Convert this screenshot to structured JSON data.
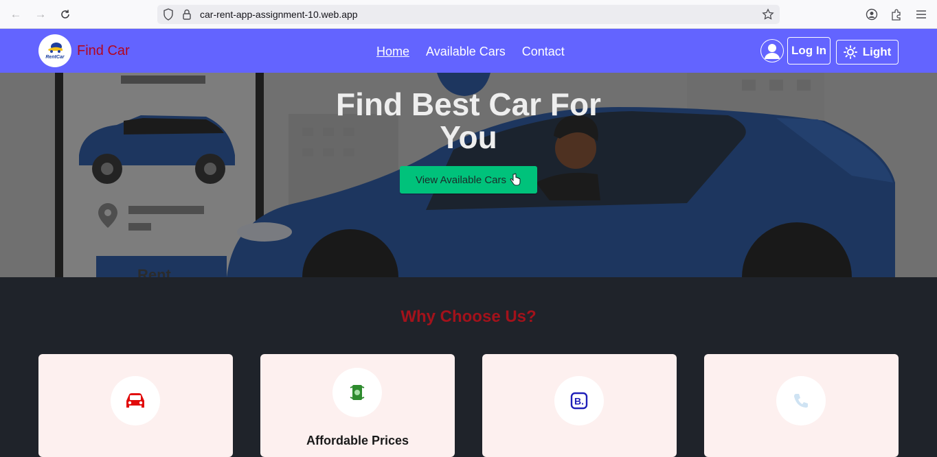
{
  "browser": {
    "url": "car-rent-app-assignment-10.web.app"
  },
  "navbar": {
    "logo_text": "RentCar",
    "brand": "Find Car",
    "links": [
      {
        "label": "Home"
      },
      {
        "label": "Available Cars"
      },
      {
        "label": "Contact"
      }
    ],
    "login_label": "Log In",
    "theme_label": "Light",
    "colors": {
      "background": "#6364ff",
      "brand": "#b3061f"
    }
  },
  "hero": {
    "title": "Find Best Car For You",
    "button_label": "View Available Cars",
    "sign_text": "Rent",
    "button_color": "#00c27b"
  },
  "why": {
    "title": "Why Choose Us?",
    "title_color": "#a3121b",
    "cards": [
      {
        "icon": "car-icon",
        "title": ""
      },
      {
        "icon": "money-icon",
        "title": "Affordable Prices"
      },
      {
        "icon": "booking-icon",
        "title": ""
      },
      {
        "icon": "phone-icon",
        "title": ""
      }
    ]
  }
}
